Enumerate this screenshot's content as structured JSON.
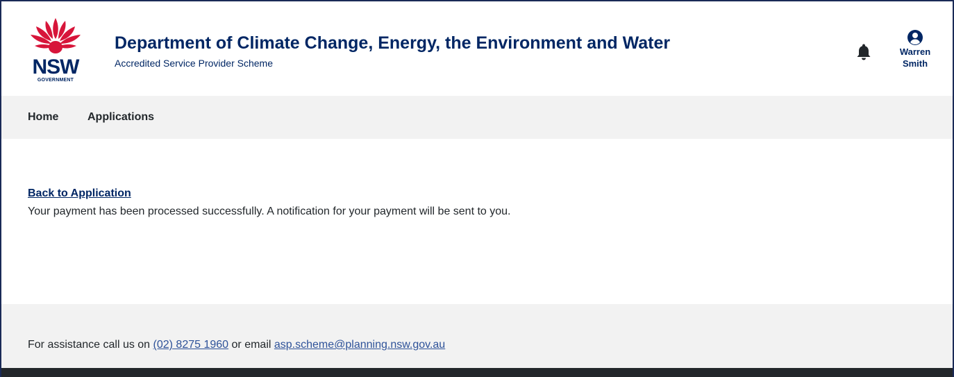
{
  "header": {
    "logo": {
      "wordmark": "NSW",
      "subtext": "GOVERNMENT",
      "icon": "waratah-icon",
      "colors": {
        "petals": "#d7153a",
        "text": "#002664"
      }
    },
    "title": "Department of Climate Change, Energy, the Environment and Water",
    "subtitle": "Accredited Service Provider Scheme",
    "notifications_icon": "bell-icon",
    "user": {
      "icon": "user-circle-icon",
      "first_name": "Warren",
      "last_name": "Smith"
    }
  },
  "nav": {
    "items": [
      {
        "label": "Home"
      },
      {
        "label": "Applications"
      }
    ]
  },
  "main": {
    "back_link": "Back to Application",
    "message": "Your payment has been processed successfully. A notification for your payment will be sent to you."
  },
  "footer": {
    "assist_prefix": "For assistance call us on",
    "phone": "(02) 8275 1960",
    "assist_middle": "or email",
    "email": "asp.scheme@planning.nsw.gov.au"
  },
  "colors": {
    "brand_navy": "#002664",
    "link": "#2e5299",
    "nav_background": "#f2f2f2",
    "bottom_bar": "#23272b"
  }
}
